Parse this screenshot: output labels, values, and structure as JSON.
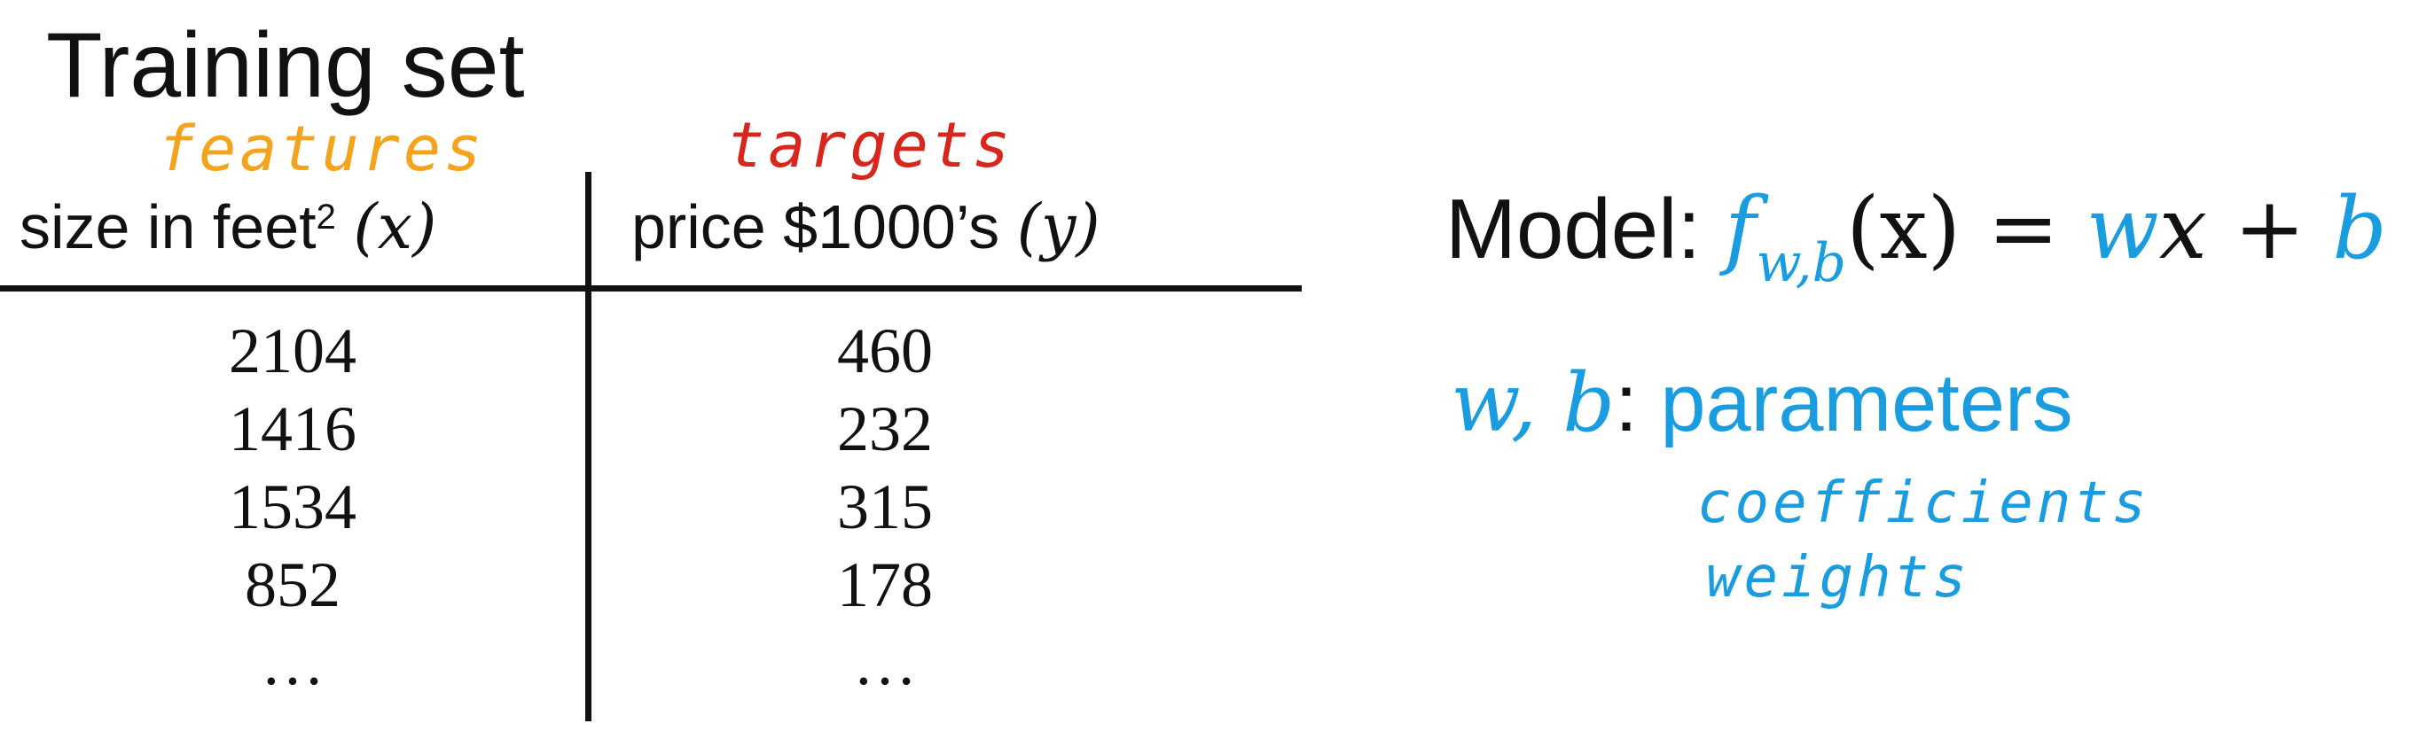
{
  "title": "Training set",
  "annotations": {
    "features": "features",
    "targets": "targets",
    "coefficients": "coefficients",
    "weights": "weights"
  },
  "table": {
    "header_size_text": "size in feet",
    "header_size_sup": "2",
    "header_size_var": "(x)",
    "header_price_text": "price $1000’s",
    "header_price_var": "(y)",
    "rows": [
      {
        "x": "2104",
        "y": "460"
      },
      {
        "x": "1416",
        "y": "232"
      },
      {
        "x": "1534",
        "y": "315"
      },
      {
        "x": "852",
        "y": "178"
      },
      {
        "x": "…",
        "y": "…"
      }
    ]
  },
  "model": {
    "label": "Model:",
    "f": "f",
    "subscript": "w,b",
    "argument": "(x)",
    "equals": " = ",
    "w": "w",
    "x": "x",
    "plus": " + ",
    "b": "b"
  },
  "parameters": {
    "symbols": "w, b",
    "colon": ":",
    "label": "parameters"
  },
  "colors": {
    "features_annotation": "#f5a31a",
    "targets_annotation": "#d9261c",
    "accent_blue": "#1a9de0",
    "text": "#111111"
  }
}
